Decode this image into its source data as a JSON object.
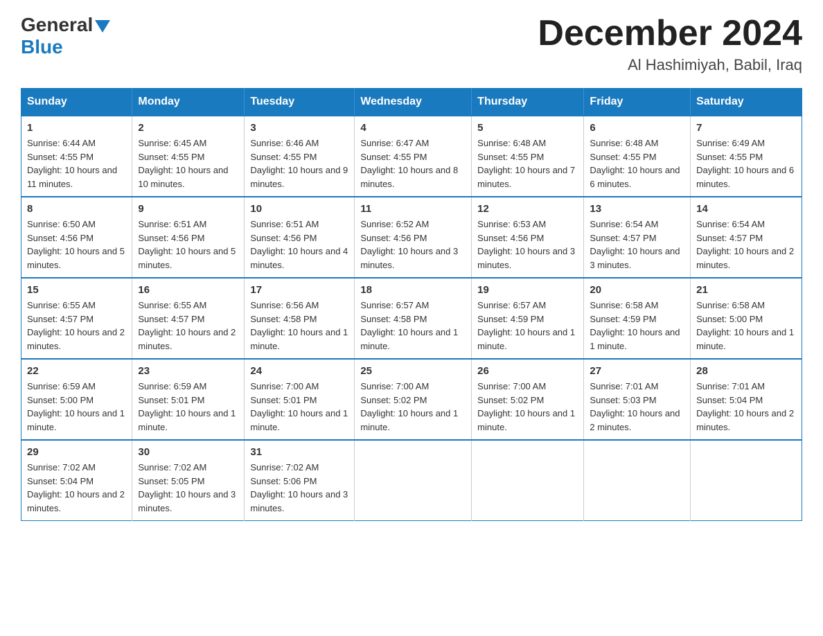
{
  "header": {
    "logo_general": "General",
    "logo_blue": "Blue",
    "month_title": "December 2024",
    "location": "Al Hashimiyah, Babil, Iraq"
  },
  "weekdays": [
    "Sunday",
    "Monday",
    "Tuesday",
    "Wednesday",
    "Thursday",
    "Friday",
    "Saturday"
  ],
  "weeks": [
    [
      {
        "day": "1",
        "sunrise": "6:44 AM",
        "sunset": "4:55 PM",
        "daylight": "10 hours and 11 minutes."
      },
      {
        "day": "2",
        "sunrise": "6:45 AM",
        "sunset": "4:55 PM",
        "daylight": "10 hours and 10 minutes."
      },
      {
        "day": "3",
        "sunrise": "6:46 AM",
        "sunset": "4:55 PM",
        "daylight": "10 hours and 9 minutes."
      },
      {
        "day": "4",
        "sunrise": "6:47 AM",
        "sunset": "4:55 PM",
        "daylight": "10 hours and 8 minutes."
      },
      {
        "day": "5",
        "sunrise": "6:48 AM",
        "sunset": "4:55 PM",
        "daylight": "10 hours and 7 minutes."
      },
      {
        "day": "6",
        "sunrise": "6:48 AM",
        "sunset": "4:55 PM",
        "daylight": "10 hours and 6 minutes."
      },
      {
        "day": "7",
        "sunrise": "6:49 AM",
        "sunset": "4:55 PM",
        "daylight": "10 hours and 6 minutes."
      }
    ],
    [
      {
        "day": "8",
        "sunrise": "6:50 AM",
        "sunset": "4:56 PM",
        "daylight": "10 hours and 5 minutes."
      },
      {
        "day": "9",
        "sunrise": "6:51 AM",
        "sunset": "4:56 PM",
        "daylight": "10 hours and 5 minutes."
      },
      {
        "day": "10",
        "sunrise": "6:51 AM",
        "sunset": "4:56 PM",
        "daylight": "10 hours and 4 minutes."
      },
      {
        "day": "11",
        "sunrise": "6:52 AM",
        "sunset": "4:56 PM",
        "daylight": "10 hours and 3 minutes."
      },
      {
        "day": "12",
        "sunrise": "6:53 AM",
        "sunset": "4:56 PM",
        "daylight": "10 hours and 3 minutes."
      },
      {
        "day": "13",
        "sunrise": "6:54 AM",
        "sunset": "4:57 PM",
        "daylight": "10 hours and 3 minutes."
      },
      {
        "day": "14",
        "sunrise": "6:54 AM",
        "sunset": "4:57 PM",
        "daylight": "10 hours and 2 minutes."
      }
    ],
    [
      {
        "day": "15",
        "sunrise": "6:55 AM",
        "sunset": "4:57 PM",
        "daylight": "10 hours and 2 minutes."
      },
      {
        "day": "16",
        "sunrise": "6:55 AM",
        "sunset": "4:57 PM",
        "daylight": "10 hours and 2 minutes."
      },
      {
        "day": "17",
        "sunrise": "6:56 AM",
        "sunset": "4:58 PM",
        "daylight": "10 hours and 1 minute."
      },
      {
        "day": "18",
        "sunrise": "6:57 AM",
        "sunset": "4:58 PM",
        "daylight": "10 hours and 1 minute."
      },
      {
        "day": "19",
        "sunrise": "6:57 AM",
        "sunset": "4:59 PM",
        "daylight": "10 hours and 1 minute."
      },
      {
        "day": "20",
        "sunrise": "6:58 AM",
        "sunset": "4:59 PM",
        "daylight": "10 hours and 1 minute."
      },
      {
        "day": "21",
        "sunrise": "6:58 AM",
        "sunset": "5:00 PM",
        "daylight": "10 hours and 1 minute."
      }
    ],
    [
      {
        "day": "22",
        "sunrise": "6:59 AM",
        "sunset": "5:00 PM",
        "daylight": "10 hours and 1 minute."
      },
      {
        "day": "23",
        "sunrise": "6:59 AM",
        "sunset": "5:01 PM",
        "daylight": "10 hours and 1 minute."
      },
      {
        "day": "24",
        "sunrise": "7:00 AM",
        "sunset": "5:01 PM",
        "daylight": "10 hours and 1 minute."
      },
      {
        "day": "25",
        "sunrise": "7:00 AM",
        "sunset": "5:02 PM",
        "daylight": "10 hours and 1 minute."
      },
      {
        "day": "26",
        "sunrise": "7:00 AM",
        "sunset": "5:02 PM",
        "daylight": "10 hours and 1 minute."
      },
      {
        "day": "27",
        "sunrise": "7:01 AM",
        "sunset": "5:03 PM",
        "daylight": "10 hours and 2 minutes."
      },
      {
        "day": "28",
        "sunrise": "7:01 AM",
        "sunset": "5:04 PM",
        "daylight": "10 hours and 2 minutes."
      }
    ],
    [
      {
        "day": "29",
        "sunrise": "7:02 AM",
        "sunset": "5:04 PM",
        "daylight": "10 hours and 2 minutes."
      },
      {
        "day": "30",
        "sunrise": "7:02 AM",
        "sunset": "5:05 PM",
        "daylight": "10 hours and 3 minutes."
      },
      {
        "day": "31",
        "sunrise": "7:02 AM",
        "sunset": "5:06 PM",
        "daylight": "10 hours and 3 minutes."
      },
      null,
      null,
      null,
      null
    ]
  ],
  "labels": {
    "sunrise": "Sunrise:",
    "sunset": "Sunset:",
    "daylight": "Daylight:"
  }
}
